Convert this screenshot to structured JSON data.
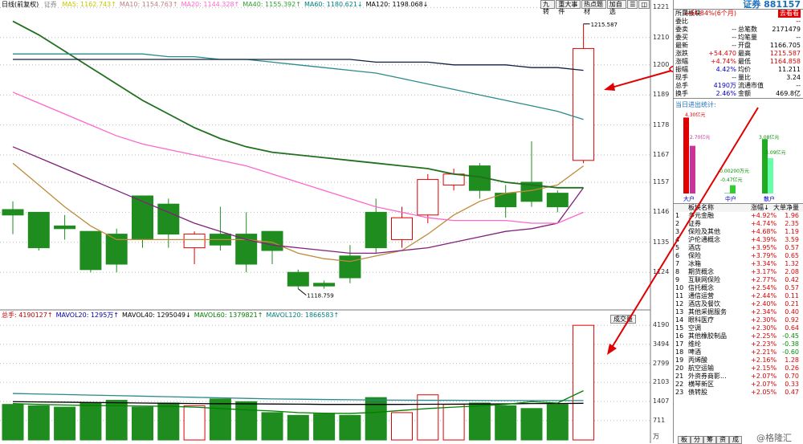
{
  "legend": {
    "k_title": "日线(前复权)",
    "k_sub": "证券",
    "ma": [
      {
        "label": "MA5: 1162.743↑",
        "color": "#c8c800"
      },
      {
        "label": "MA10: 1154.763↑",
        "color": "#c08080"
      },
      {
        "label": "MA20: 1144.328↑",
        "color": "#ff66cc"
      },
      {
        "label": "MA40: 1155.392↑",
        "color": "#30a030"
      },
      {
        "label": "MA60: 1180.621↓",
        "color": "#008080"
      },
      {
        "label": "MA120: 1198.068↓",
        "color": "#000000"
      }
    ],
    "vol": [
      {
        "label": "总手: 4190127↑",
        "color": "#c00000"
      },
      {
        "label": "MAVOL20: 1295万↑",
        "color": "#0000aa"
      },
      {
        "label": "MAVOL40: 1295049↓",
        "color": "#000000"
      },
      {
        "label": "MAVOL60: 1379821↑",
        "color": "#008000"
      },
      {
        "label": "MAVOL120: 1866583↑",
        "color": "#008080"
      }
    ]
  },
  "toolbar": [
    "九转",
    "重大事件",
    "热点题材",
    "加自选",
    "☰",
    "◫"
  ],
  "vol_btn": "成交量",
  "unit_label": "万",
  "side": {
    "title": "证券 881157",
    "rows": [
      {
        "a": "所属板块",
        "b": "+44.84%(6个月)",
        "c": "",
        "d": "去看看",
        "bcls": "red"
      },
      {
        "a": "委比",
        "b": "",
        "c": "",
        "d": "--",
        "bcls": ""
      },
      {
        "a": "委卖",
        "b": "--",
        "c": "总笔数",
        "d": "2171479",
        "bcls": ""
      },
      {
        "a": "委买",
        "b": "--",
        "c": "均笔量",
        "d": "--",
        "bcls": ""
      },
      {
        "a": "最新",
        "b": "--",
        "c": "开盘",
        "d": "1166.705",
        "bcls": ""
      },
      {
        "a": "涨跌",
        "b": "+54.470",
        "c": "最高",
        "d": "1215.587",
        "bcls": "red"
      },
      {
        "a": "涨幅",
        "b": "+4.74%",
        "c": "最低",
        "d": "1164.858",
        "bcls": "red"
      },
      {
        "a": "振幅",
        "b": "4.42%",
        "c": "均价",
        "d": "11.211",
        "bcls": "blue"
      },
      {
        "a": "现手",
        "b": "--",
        "c": "量比",
        "d": "3.24",
        "bcls": ""
      },
      {
        "a": "总手",
        "b": "4190万",
        "c": "流通市值",
        "d": "--",
        "bcls": "blue"
      },
      {
        "a": "换手",
        "b": "2.46%",
        "c": "金额",
        "d": "469.8亿",
        "bcls": "blue"
      }
    ],
    "flow_title": "当日进出统计:",
    "flow": {
      "big_label": "大户",
      "mid_label": "中户",
      "small_label": "散户",
      "big_in": 4.3,
      "big_out": 2.7,
      "mid_in": 0.02,
      "mid_out": 0.47,
      "small_in": 3.08,
      "small_out": 2.0,
      "big_in_txt": "4.30亿元",
      "big_out_txt": "2.70亿元",
      "mid_in_txt": "-0.00200万元",
      "mid_out_txt": "-0.47亿元",
      "small_in_txt": "3.08亿元",
      "small_out_txt": "-3.09亿元"
    },
    "blist_head": {
      "n": "板块名称",
      "p": "涨幅↓",
      "q": "大单净量"
    },
    "blist": [
      {
        "n": "1",
        "nm": "多元金融",
        "pc": "+4.92%",
        "nt": "1.96"
      },
      {
        "n": "2",
        "nm": "证券",
        "pc": "+4.74%",
        "nt": "2.35"
      },
      {
        "n": "3",
        "nm": "保险及其他",
        "pc": "+4.68%",
        "nt": "1.19"
      },
      {
        "n": "4",
        "nm": "沪伦通概念",
        "pc": "+4.39%",
        "nt": "3.59"
      },
      {
        "n": "5",
        "nm": "酒店",
        "pc": "+3.95%",
        "nt": "0.57"
      },
      {
        "n": "6",
        "nm": "保险",
        "pc": "+3.79%",
        "nt": "0.65"
      },
      {
        "n": "7",
        "nm": "冰箱",
        "pc": "+3.34%",
        "nt": "1.32"
      },
      {
        "n": "8",
        "nm": "期货概念",
        "pc": "+3.17%",
        "nt": "2.08"
      },
      {
        "n": "9",
        "nm": "互联网保险",
        "pc": "+2.77%",
        "nt": "0.42"
      },
      {
        "n": "10",
        "nm": "信托概念",
        "pc": "+2.54%",
        "nt": "0.57"
      },
      {
        "n": "11",
        "nm": "通信运营",
        "pc": "+2.44%",
        "nt": "0.11"
      },
      {
        "n": "12",
        "nm": "酒店及餐饮",
        "pc": "+2.40%",
        "nt": "0.21"
      },
      {
        "n": "13",
        "nm": "其他采掘服务",
        "pc": "+2.34%",
        "nt": "0.40"
      },
      {
        "n": "14",
        "nm": "眼科医疗",
        "pc": "+2.30%",
        "nt": "0.92"
      },
      {
        "n": "15",
        "nm": "空调",
        "pc": "+2.30%",
        "nt": "0.64"
      },
      {
        "n": "16",
        "nm": "其他橡胶制品",
        "pc": "+2.25%",
        "nt": "-0.45"
      },
      {
        "n": "17",
        "nm": "维纶",
        "pc": "+2.23%",
        "nt": "-0.38"
      },
      {
        "n": "18",
        "nm": "啤酒",
        "pc": "+2.21%",
        "nt": "-0.60"
      },
      {
        "n": "19",
        "nm": "丙烯酸",
        "pc": "+2.16%",
        "nt": "1.28"
      },
      {
        "n": "20",
        "nm": "航空运输",
        "pc": "+2.15%",
        "nt": "0.26"
      },
      {
        "n": "21",
        "nm": "外资券商影...",
        "pc": "+2.07%",
        "nt": "0.70"
      },
      {
        "n": "22",
        "nm": "横琴新区",
        "pc": "+2.07%",
        "nt": "0.33"
      },
      {
        "n": "23",
        "nm": "债转股",
        "pc": "+2.05%",
        "nt": "0.47"
      }
    ],
    "tabs": [
      "板",
      "分",
      "筹",
      "资",
      "成"
    ]
  },
  "watermark": "@格隆汇",
  "chart_data": {
    "type": "candlestick",
    "price_axis": {
      "min": 1112,
      "max": 1222,
      "ticks": [
        1124,
        1135,
        1146,
        1157,
        1167,
        1178,
        1189,
        1200,
        1210,
        1221
      ]
    },
    "vol_axis": {
      "min": 0,
      "max": 4400,
      "ticks": [
        711,
        1407,
        2103,
        2799,
        3494,
        4190
      ]
    },
    "annotations": {
      "high": "1215.587",
      "low": "1118.759"
    },
    "candles": [
      {
        "o": 1147,
        "c": 1145,
        "h": 1150,
        "l": 1138,
        "v": 1300
      },
      {
        "o": 1146,
        "c": 1133,
        "h": 1146,
        "l": 1132,
        "v": 1250
      },
      {
        "o": 1141,
        "c": 1140,
        "h": 1145,
        "l": 1136,
        "v": 1200
      },
      {
        "o": 1139,
        "c": 1125,
        "h": 1139,
        "l": 1124,
        "v": 1350
      },
      {
        "o": 1138,
        "c": 1127,
        "h": 1140,
        "l": 1124,
        "v": 1450
      },
      {
        "o": 1152,
        "c": 1136,
        "h": 1152,
        "l": 1133,
        "v": 1200
      },
      {
        "o": 1149,
        "c": 1138,
        "h": 1151,
        "l": 1133,
        "v": 1350
      },
      {
        "o": 1133,
        "c": 1138,
        "h": 1139,
        "l": 1127,
        "v": 1250
      },
      {
        "o": 1138,
        "c": 1134,
        "h": 1148,
        "l": 1132,
        "v": 1500
      },
      {
        "o": 1138,
        "c": 1127,
        "h": 1146,
        "l": 1124,
        "v": 1400
      },
      {
        "o": 1139,
        "c": 1132,
        "h": 1139,
        "l": 1127,
        "v": 1000
      },
      {
        "o": 1124,
        "c": 1119,
        "h": 1125,
        "l": 1118,
        "v": 900
      },
      {
        "o": 1120,
        "c": 1119,
        "h": 1121,
        "l": 1118,
        "v": 950
      },
      {
        "o": 1130,
        "c": 1122,
        "h": 1134,
        "l": 1120,
        "v": 900
      },
      {
        "o": 1146,
        "c": 1133,
        "h": 1151,
        "l": 1131,
        "v": 1550
      },
      {
        "o": 1136,
        "c": 1144,
        "h": 1148,
        "l": 1133,
        "v": 1000
      },
      {
        "o": 1145,
        "c": 1158,
        "h": 1160,
        "l": 1142,
        "v": 1650
      },
      {
        "o": 1156,
        "c": 1160,
        "h": 1162,
        "l": 1154,
        "v": 1300
      },
      {
        "o": 1163,
        "c": 1154,
        "h": 1164,
        "l": 1151,
        "v": 1350
      },
      {
        "o": 1153,
        "c": 1148,
        "h": 1156,
        "l": 1144,
        "v": 1250
      },
      {
        "o": 1157,
        "c": 1150,
        "h": 1172,
        "l": 1148,
        "v": 1150
      },
      {
        "o": 1153,
        "c": 1148,
        "h": 1154,
        "l": 1146,
        "v": 1300
      },
      {
        "o": 1165,
        "c": 1206,
        "h": 1215,
        "l": 1164,
        "v": 4190
      }
    ],
    "ma": [
      {
        "name": "MA5",
        "color": "#c08a3a",
        "values": [
          1164,
          1156,
          1148,
          1141,
          1136,
          1136,
          1136,
          1136,
          1136,
          1136,
          1135,
          1131,
          1129,
          1128,
          1130,
          1132,
          1138,
          1145,
          1150,
          1153,
          1154,
          1156,
          1163
        ]
      },
      {
        "name": "MA10",
        "color": "#80207a",
        "values": [
          1170,
          1166,
          1162,
          1158,
          1154,
          1150,
          1146,
          1142,
          1139,
          1136,
          1134,
          1133,
          1132,
          1131,
          1131,
          1132,
          1133,
          1135,
          1137,
          1139,
          1140,
          1142,
          1155
        ]
      },
      {
        "name": "MA20",
        "color": "#ff66cc",
        "values": [
          1190,
          1186,
          1182,
          1178,
          1174,
          1171,
          1169,
          1167,
          1165,
          1163,
          1160,
          1157,
          1154,
          1151,
          1148,
          1146,
          1144,
          1143,
          1143,
          1143,
          1142,
          1142,
          1146
        ]
      },
      {
        "name": "MA40",
        "color": "#207020",
        "values": [
          1216,
          1211,
          1205,
          1199,
          1193,
          1187,
          1182,
          1177,
          1173,
          1170,
          1168,
          1167,
          1166,
          1165,
          1164,
          1163,
          1162,
          1160,
          1159,
          1157,
          1156,
          1155,
          1155
        ]
      },
      {
        "name": "MA60",
        "color": "#2a8a8a",
        "values": [
          1204,
          1204,
          1204,
          1204,
          1204,
          1204,
          1203,
          1203,
          1202,
          1202,
          1201,
          1200,
          1199,
          1198,
          1197,
          1195,
          1193,
          1191,
          1189,
          1187,
          1185,
          1183,
          1180
        ]
      },
      {
        "name": "MA120",
        "color": "#102040",
        "values": [
          1202,
          1202,
          1202,
          1202,
          1202,
          1202,
          1202,
          1202,
          1202,
          1202,
          1202,
          1202,
          1202,
          1202,
          1201,
          1201,
          1201,
          1200,
          1200,
          1200,
          1199,
          1199,
          1198
        ]
      }
    ],
    "vol_ma": [
      {
        "name": "MAVOL20",
        "color": "#2a8a8a",
        "values": [
          1700,
          1680,
          1660,
          1640,
          1620,
          1600,
          1580,
          1560,
          1540,
          1520,
          1500,
          1490,
          1480,
          1470,
          1460,
          1455,
          1450,
          1450,
          1445,
          1440,
          1440,
          1440,
          1440
        ]
      },
      {
        "name": "MAVOL40",
        "color": "#000000",
        "values": [
          1400,
          1390,
          1380,
          1370,
          1360,
          1350,
          1340,
          1330,
          1325,
          1320,
          1315,
          1310,
          1300,
          1300,
          1300,
          1300,
          1305,
          1310,
          1315,
          1320,
          1330,
          1330,
          1340
        ]
      },
      {
        "name": "MAVOL60",
        "color": "#008000",
        "values": [
          1330,
          1300,
          1280,
          1260,
          1250,
          1240,
          1230,
          1200,
          1150,
          1100,
          1060,
          1000,
          980,
          970,
          1010,
          1080,
          1150,
          1200,
          1250,
          1300,
          1400,
          1350,
          1800
        ]
      }
    ]
  }
}
